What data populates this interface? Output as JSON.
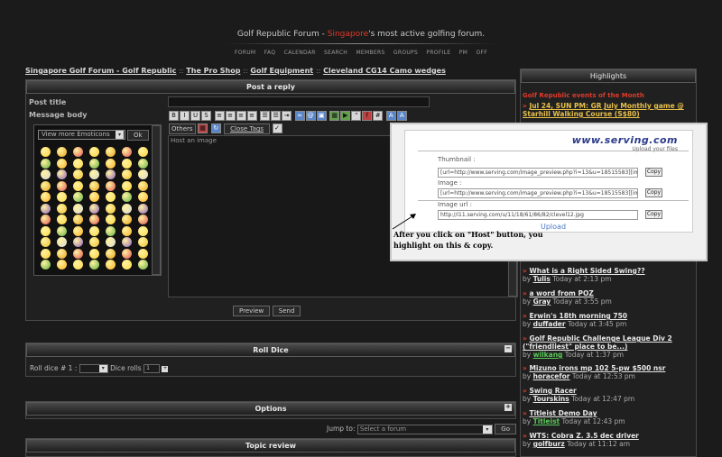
{
  "header": {
    "title_prefix": "Golf Republic Forum - ",
    "title_highlight": "Singapore",
    "title_suffix": "'s most active golfing forum.",
    "nav": [
      "FORUM",
      "FAQ",
      "CALENDAR",
      "SEARCH",
      "MEMBERS",
      "GROUPS",
      "PROFILE",
      "PM",
      "OFF"
    ]
  },
  "breadcrumb": [
    "Singapore Golf Forum - Golf Republic",
    "The Pro Shop",
    "Golf Equipment",
    "Cleveland CG14 Camo wedges"
  ],
  "breadcrumb_sep": "::",
  "post_reply": {
    "title": "Post a reply",
    "post_title_label": "Post title",
    "message_body_label": "Message body",
    "emoticons_select": "View more Emoticons",
    "ok_button": "Ok",
    "others_button": "Others",
    "close_tags": "Close Tags",
    "host_image_text": "Host an image",
    "preview_button": "Preview",
    "send_button": "Send"
  },
  "roll_dice": {
    "title": "Roll Dice",
    "roll_label": "Roll dice # 1 :",
    "dice_rolls_label": "Dice rolls",
    "dice_rolls_value": "1",
    "collapse_icon": "minus"
  },
  "options": {
    "title": "Options",
    "expand_icon": "plus",
    "jump_to_label": "Jump to:",
    "jump_to_value": "Select a forum",
    "go_button": "Go"
  },
  "topic_review": {
    "title": "Topic review"
  },
  "sidebar": {
    "title": "Highlights",
    "events_heading": "Golf Republic events of the Month",
    "event_item": "Jul 24, SUN PM: GR July Monthly game @ Starhill Walking Course (S$80)",
    "items": [
      {
        "title": "What is a Right Sided Swing??",
        "by": "Tulis",
        "time": "Today at 2:13 pm"
      },
      {
        "title": "a word from POZ",
        "by": "Gray",
        "time": "Today at 3:55 pm"
      },
      {
        "title": "Erwin's 18th morning 750",
        "by": "duffader",
        "time": "Today at 3:45 pm"
      },
      {
        "title": "Golf Republic Challenge League   Div 2 (\"friendliest\" place to be...)",
        "by": "wilkang",
        "time": "Today at 1:37 pm"
      },
      {
        "title": "Mizuno irons mp 102 5-pw $500 nsr",
        "by": "horacefor",
        "time": "Today at 12:53 pm"
      },
      {
        "title": "Swing Racer",
        "by": "Tourskins",
        "time": "Today at 12:47 pm"
      },
      {
        "title": "Titleist Demo Day",
        "by": "Titleist",
        "time": "Today at 12:43 pm"
      },
      {
        "title": "WTS: Cobra Z. 3.5 dec driver",
        "by": "golfburz",
        "time": "Today at 11:12 am"
      }
    ],
    "by_label": "by"
  },
  "popup": {
    "logo": "www.serving.com",
    "logo_sub": "Upload your files",
    "thumbnail_label": "Thumbnail :",
    "thumbnail_value": "[url=http://www.serving.com/image_preview.php?i=13&u=18515583][im",
    "image_label": "Image :",
    "image_value": "[url=http://www.serving.com/image_preview.php?i=13&u=18515583][im",
    "url_label": "Image url :",
    "url_value": "http://i11.serving.com/u/11/18/61/86/82/clevel12.jpg",
    "copy_button": "Copy",
    "upload_link": "Upload",
    "caption_line1": "After you click on \"Host\" button, you",
    "caption_line2": "highlight on this & copy."
  },
  "colors": {
    "accent": "#e03a2a",
    "background": "#1b1b1b",
    "panel": "#202020"
  }
}
